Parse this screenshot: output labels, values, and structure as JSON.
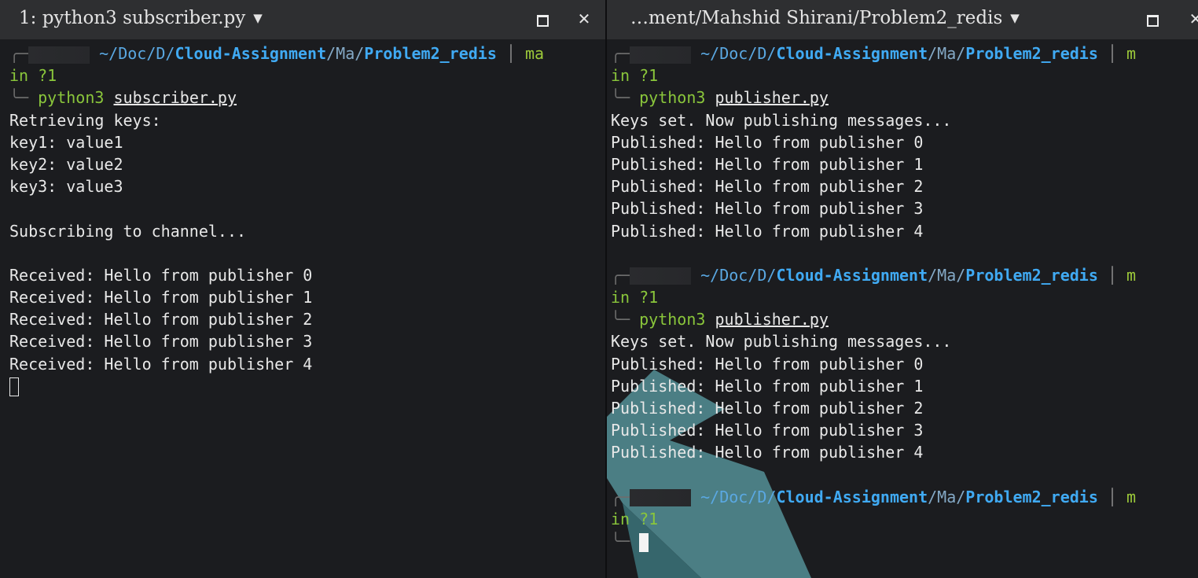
{
  "left_pane": {
    "title": "1: python3 subscriber.py",
    "prompt": {
      "path_prefix": "~/Doc/D/",
      "path_bold": "Cloud-Assignment",
      "path_mid": "/Ma/",
      "path_end": "Problem2_redis",
      "branch": "ma",
      "status": "in ?1",
      "cmd": "python3",
      "script": "subscriber.py"
    },
    "output": [
      "Retrieving keys:",
      "key1: value1",
      "key2: value2",
      "key3: value3",
      "",
      "Subscribing to channel...",
      "",
      "Received: Hello from publisher 0",
      "Received: Hello from publisher 1",
      "Received: Hello from publisher 2",
      "Received: Hello from publisher 3",
      "Received: Hello from publisher 4"
    ]
  },
  "right_pane": {
    "title": "…ment/Mahshid Shirani/Problem2_redis",
    "prompt": {
      "path_prefix": "~/Doc/D/",
      "path_bold": "Cloud-Assignment",
      "path_mid": "/Ma/",
      "path_end": "Problem2_redis",
      "branch": "m",
      "status": "in ?1",
      "cmd": "python3",
      "script": "publisher.py"
    },
    "run1": [
      "Keys set. Now publishing messages...",
      "Published: Hello from publisher 0",
      "Published: Hello from publisher 1",
      "Published: Hello from publisher 2",
      "Published: Hello from publisher 3",
      "Published: Hello from publisher 4"
    ],
    "run2": [
      "Keys set. Now publishing messages...",
      "Published: Hello from publisher 0",
      "Published: Hello from publisher 1",
      "Published: Hello from publisher 2",
      "Published: Hello from publisher 3",
      "Published: Hello from publisher 4"
    ]
  },
  "colors": {
    "path": "#40aaf3",
    "green": "#8ac63b",
    "background": "#1b1c1f",
    "titlebar": "#2e2f31"
  },
  "icons": {
    "maximize": "maximize-icon",
    "close": "close-icon",
    "dropdown": "chevron-down-icon"
  }
}
